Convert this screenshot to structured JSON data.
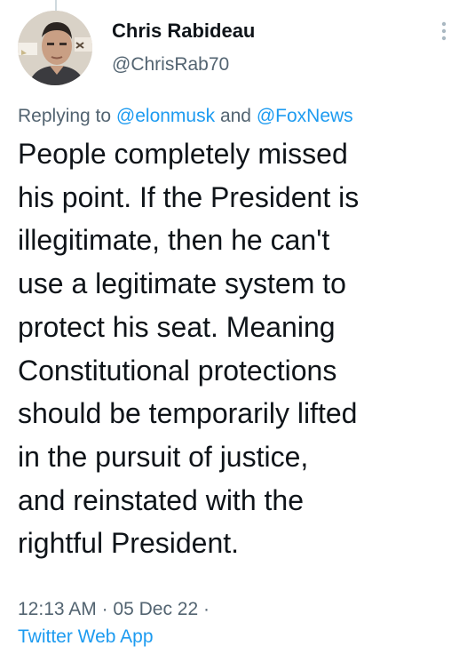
{
  "tweet": {
    "author": {
      "display_name": "Chris Rabideau",
      "handle": "@ChrisRab70",
      "avatar_icon": "user-photo-avatar"
    },
    "reply_prefix": "Replying to",
    "reply_mentions": [
      "@elonmusk",
      "@FoxNews"
    ],
    "reply_joiner": "and",
    "text_lines": [
      "People completely missed",
      "his point. If the President is",
      "illegitimate, then he can't",
      "use a legitimate system to",
      "protect his seat. Meaning",
      "Constitutional protections",
      "should be temporarily lifted",
      "in the pursuit of justice,",
      "and reinstated with the",
      "rightful President."
    ],
    "time": "12:13 AM",
    "date": "05 Dec 22",
    "separator": "·",
    "source": "Twitter Web App",
    "more_icon": "more-vertical-icon"
  },
  "colors": {
    "text_primary": "#0f1419",
    "text_secondary": "#536471",
    "link": "#1d9bf0",
    "background": "#ffffff"
  }
}
